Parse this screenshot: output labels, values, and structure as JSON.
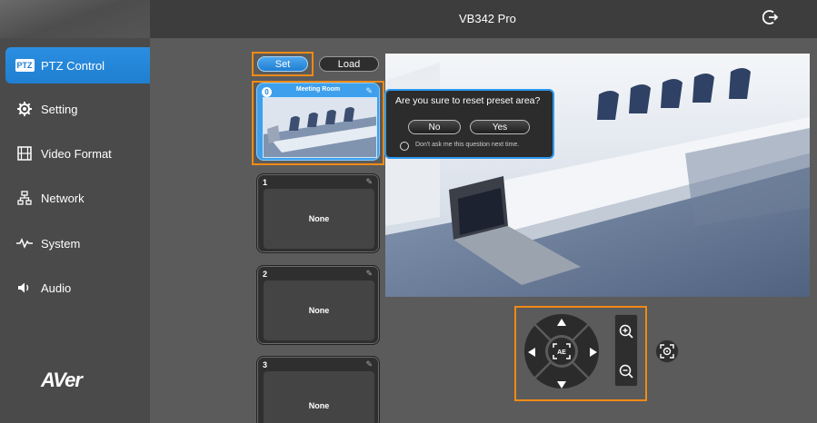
{
  "app": {
    "title": "VB342 Pro",
    "brand": "AVer"
  },
  "sidebar": {
    "items": [
      {
        "label": "PTZ Control",
        "icon": "ptz-badge-icon",
        "badge": "PTZ",
        "active": true
      },
      {
        "label": "Setting",
        "icon": "gear-icon"
      },
      {
        "label": "Video Format",
        "icon": "film-icon"
      },
      {
        "label": "Network",
        "icon": "network-icon"
      },
      {
        "label": "System",
        "icon": "pulse-icon"
      },
      {
        "label": "Audio",
        "icon": "speaker-icon"
      }
    ]
  },
  "toolbar": {
    "set_label": "Set",
    "load_label": "Load"
  },
  "presets": [
    {
      "num": "0",
      "name": "Meeting Room",
      "selected": true
    },
    {
      "num": "1",
      "name": "None"
    },
    {
      "num": "2",
      "name": "None"
    },
    {
      "num": "3",
      "name": "None"
    }
  ],
  "dialog": {
    "question": "Are you sure to reset preset area?",
    "no_label": "No",
    "yes_label": "Yes",
    "dont_ask": "Don't ask me this question next time."
  },
  "colors": {
    "accent": "#1f7fd1",
    "highlight": "#f08a16",
    "sidebar": "#4a4a4a",
    "topbar": "#3d3d3d"
  }
}
